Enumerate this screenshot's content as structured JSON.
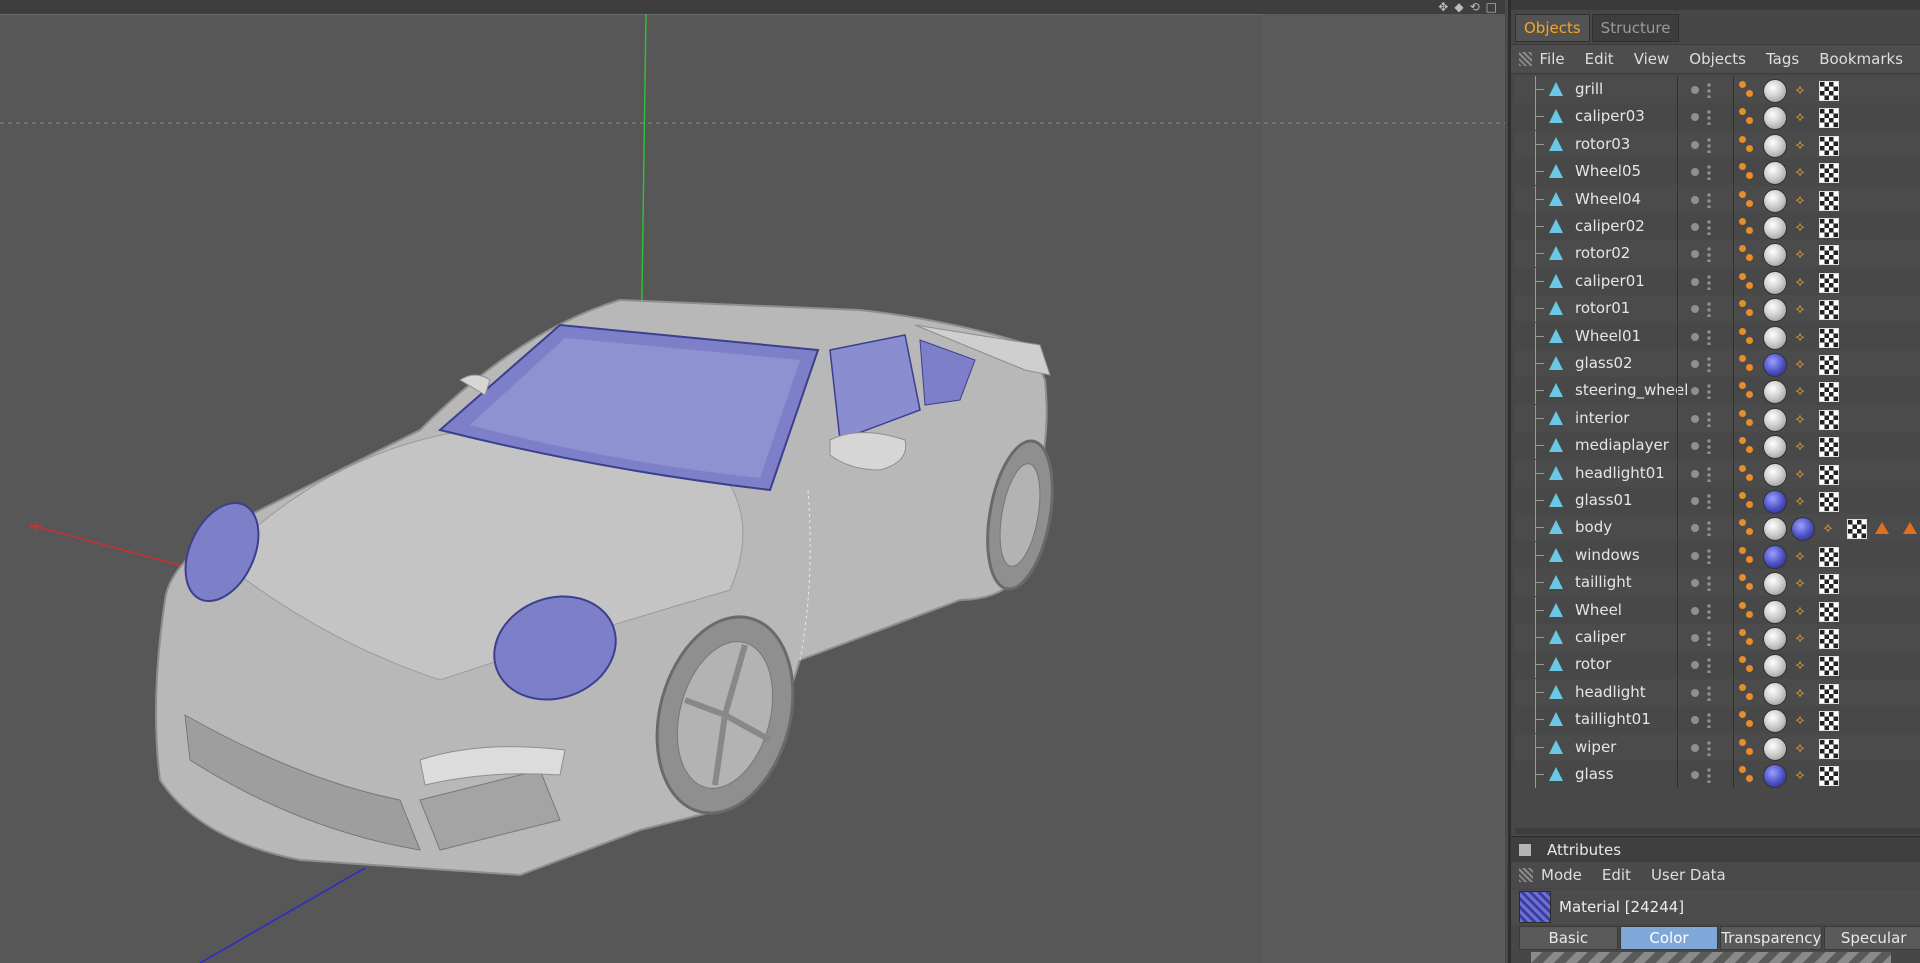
{
  "object_manager": {
    "tabs": [
      {
        "label": "Objects",
        "active": true
      },
      {
        "label": "Structure",
        "active": false
      }
    ],
    "menu": [
      "File",
      "Edit",
      "View",
      "Objects",
      "Tags",
      "Bookmarks"
    ],
    "objects": [
      {
        "name": "grill",
        "tags": [
          "mat-white",
          "bird",
          "check"
        ]
      },
      {
        "name": "caliper03",
        "tags": [
          "mat-white",
          "bird",
          "check"
        ]
      },
      {
        "name": "rotor03",
        "tags": [
          "mat-white",
          "bird",
          "check"
        ]
      },
      {
        "name": "Wheel05",
        "tags": [
          "mat-white",
          "bird",
          "check"
        ]
      },
      {
        "name": "Wheel04",
        "tags": [
          "mat-white",
          "bird",
          "check"
        ]
      },
      {
        "name": "caliper02",
        "tags": [
          "mat-white",
          "bird",
          "check"
        ]
      },
      {
        "name": "rotor02",
        "tags": [
          "mat-white",
          "bird",
          "check"
        ]
      },
      {
        "name": "caliper01",
        "tags": [
          "mat-white",
          "bird",
          "check"
        ]
      },
      {
        "name": "rotor01",
        "tags": [
          "mat-white",
          "bird",
          "check"
        ]
      },
      {
        "name": "Wheel01",
        "tags": [
          "mat-white",
          "bird",
          "check"
        ]
      },
      {
        "name": "glass02",
        "tags": [
          "mat-blue",
          "bird",
          "check"
        ]
      },
      {
        "name": "steering_wheel",
        "tags": [
          "mat-white",
          "bird",
          "check"
        ]
      },
      {
        "name": "interior",
        "tags": [
          "mat-white",
          "bird",
          "check"
        ]
      },
      {
        "name": "mediaplayer",
        "tags": [
          "mat-white",
          "bird",
          "check"
        ]
      },
      {
        "name": "headlight01",
        "tags": [
          "mat-white",
          "bird",
          "check"
        ]
      },
      {
        "name": "glass01",
        "tags": [
          "mat-blue",
          "bird",
          "check"
        ]
      },
      {
        "name": "body",
        "tags": [
          "mat-white",
          "mat-blue",
          "bird",
          "check",
          "warn",
          "warn"
        ]
      },
      {
        "name": "windows",
        "tags": [
          "mat-blue",
          "bird",
          "check"
        ]
      },
      {
        "name": "taillight",
        "tags": [
          "mat-white",
          "bird",
          "check"
        ]
      },
      {
        "name": "Wheel",
        "tags": [
          "mat-white",
          "bird",
          "check"
        ]
      },
      {
        "name": "caliper",
        "tags": [
          "mat-white",
          "bird",
          "check"
        ]
      },
      {
        "name": "rotor",
        "tags": [
          "mat-white",
          "bird",
          "check"
        ]
      },
      {
        "name": "headlight",
        "tags": [
          "mat-white",
          "bird",
          "check"
        ]
      },
      {
        "name": "taillight01",
        "tags": [
          "mat-white",
          "bird",
          "check"
        ]
      },
      {
        "name": "wiper",
        "tags": [
          "mat-white",
          "bird",
          "check"
        ]
      },
      {
        "name": "glass",
        "tags": [
          "mat-blue",
          "bird",
          "check"
        ]
      }
    ]
  },
  "attributes": {
    "title": "Attributes",
    "menu": [
      "Mode",
      "Edit",
      "User Data"
    ],
    "material_label": "Material [24244]",
    "subtabs": [
      {
        "label": "Basic",
        "active": false
      },
      {
        "label": "Color",
        "active": true
      },
      {
        "label": "Transparency",
        "active": false
      },
      {
        "label": "Specular",
        "active": false
      }
    ]
  },
  "colors": {
    "accent_tab": "#f5a623",
    "active_subtab": "#7fa8d8",
    "object_icon": "#6bc7e6",
    "glass_material": "#4a4fc2",
    "axis_y": "#2fbf3a",
    "axis_x": "#c83232",
    "axis_z": "#2a2acc"
  }
}
